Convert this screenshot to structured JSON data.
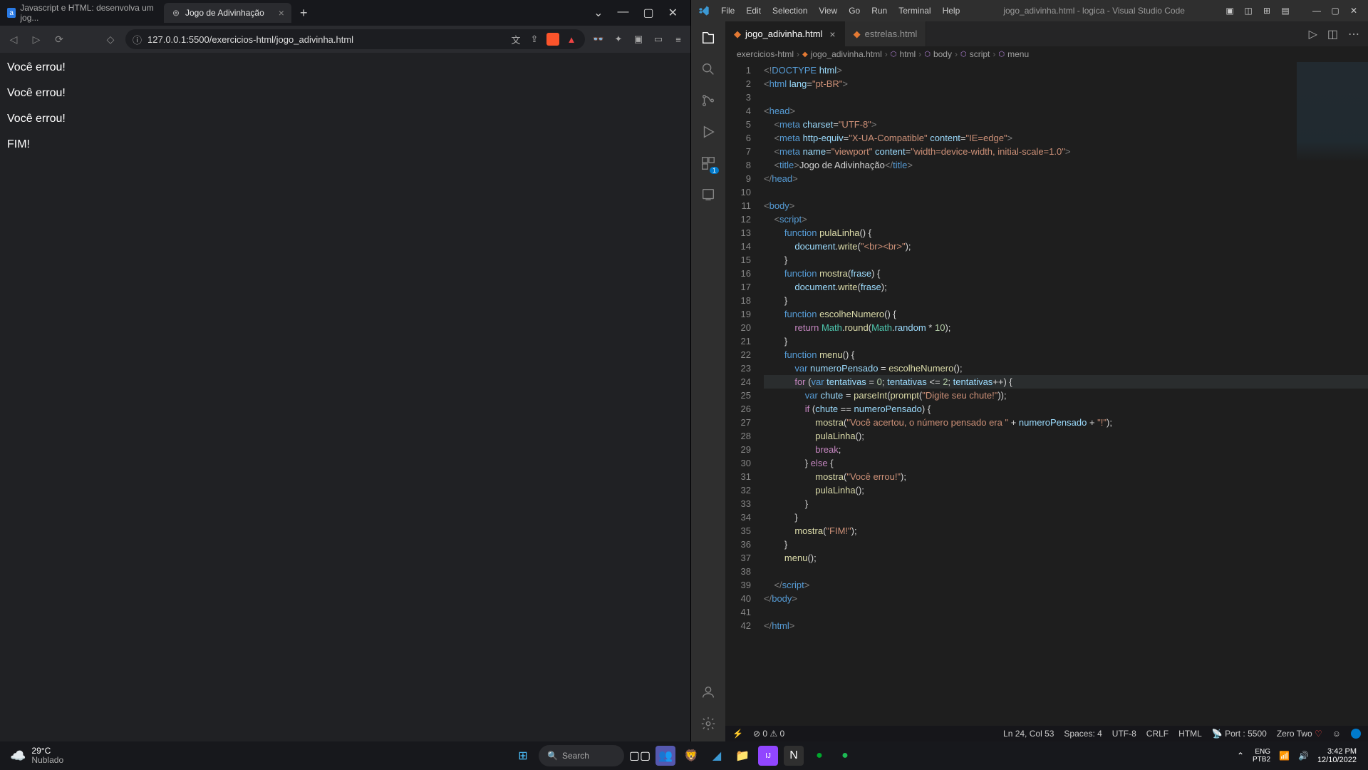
{
  "browser": {
    "tabs": [
      {
        "title": "Javascript e HTML: desenvolva um jog...",
        "icon": "a"
      },
      {
        "title": "Jogo de Adivinhação",
        "active": true
      }
    ],
    "url": "127.0.0.1:5500/exercicios-html/jogo_adivinha.html",
    "page_lines": [
      "Você errou!",
      "Você errou!",
      "Você errou!",
      "FIM!"
    ]
  },
  "vscode": {
    "title": "jogo_adivinha.html - logica - Visual Studio Code",
    "menus": [
      "File",
      "Edit",
      "Selection",
      "View",
      "Go",
      "Run",
      "Terminal",
      "Help"
    ],
    "tabs": [
      {
        "name": "jogo_adivinha.html",
        "active": true
      },
      {
        "name": "estrelas.html",
        "active": false
      }
    ],
    "breadcrumbs": [
      "exercicios-html",
      "jogo_adivinha.html",
      "html",
      "body",
      "script",
      "menu"
    ],
    "extensions_badge": "1",
    "status": {
      "errors": "0",
      "warnings": "0",
      "ln_col": "Ln 24, Col 53",
      "spaces": "Spaces: 4",
      "encoding": "UTF-8",
      "eol": "CRLF",
      "lang": "HTML",
      "port": "Port : 5500",
      "theme": "Zero Two"
    },
    "code": [
      {
        "n": 1,
        "html": "<span class='tk-tag'>&lt;!</span><span class='tk-doctype'>DOCTYPE</span> <span class='tk-attr'>html</span><span class='tk-tag'>&gt;</span>"
      },
      {
        "n": 2,
        "html": "<span class='tk-tag'>&lt;</span><span class='tk-el'>html</span> <span class='tk-attr'>lang</span>=<span class='tk-str'>\"pt-BR\"</span><span class='tk-tag'>&gt;</span>"
      },
      {
        "n": 3,
        "html": ""
      },
      {
        "n": 4,
        "html": "<span class='tk-tag'>&lt;</span><span class='tk-el'>head</span><span class='tk-tag'>&gt;</span>"
      },
      {
        "n": 5,
        "html": "    <span class='tk-tag'>&lt;</span><span class='tk-el'>meta</span> <span class='tk-attr'>charset</span>=<span class='tk-str'>\"UTF-8\"</span><span class='tk-tag'>&gt;</span>"
      },
      {
        "n": 6,
        "html": "    <span class='tk-tag'>&lt;</span><span class='tk-el'>meta</span> <span class='tk-attr'>http-equiv</span>=<span class='tk-str'>\"X-UA-Compatible\"</span> <span class='tk-attr'>content</span>=<span class='tk-str'>\"IE=edge\"</span><span class='tk-tag'>&gt;</span>"
      },
      {
        "n": 7,
        "html": "    <span class='tk-tag'>&lt;</span><span class='tk-el'>meta</span> <span class='tk-attr'>name</span>=<span class='tk-str'>\"viewport\"</span> <span class='tk-attr'>content</span>=<span class='tk-str'>\"width=device-width, initial-scale=1.0\"</span><span class='tk-tag'>&gt;</span>"
      },
      {
        "n": 8,
        "html": "    <span class='tk-tag'>&lt;</span><span class='tk-el'>title</span><span class='tk-tag'>&gt;</span>Jogo de Adivinhação<span class='tk-tag'>&lt;/</span><span class='tk-el'>title</span><span class='tk-tag'>&gt;</span>"
      },
      {
        "n": 9,
        "html": "<span class='tk-tag'>&lt;/</span><span class='tk-el'>head</span><span class='tk-tag'>&gt;</span>"
      },
      {
        "n": 10,
        "html": ""
      },
      {
        "n": 11,
        "html": "<span class='tk-tag'>&lt;</span><span class='tk-el'>body</span><span class='tk-tag'>&gt;</span>"
      },
      {
        "n": 12,
        "html": "    <span class='tk-tag'>&lt;</span><span class='tk-el'>script</span><span class='tk-tag'>&gt;</span>"
      },
      {
        "n": 13,
        "html": "        <span class='tk-kw'>function</span> <span class='tk-fn'>pulaLinha</span>() {"
      },
      {
        "n": 14,
        "html": "            <span class='tk-var'>document</span>.<span class='tk-fn'>write</span>(<span class='tk-str'>\"&lt;br&gt;&lt;br&gt;\"</span>);"
      },
      {
        "n": 15,
        "html": "        }"
      },
      {
        "n": 16,
        "html": "        <span class='tk-kw'>function</span> <span class='tk-fn'>mostra</span>(<span class='tk-var'>frase</span>) {"
      },
      {
        "n": 17,
        "html": "            <span class='tk-var'>document</span>.<span class='tk-fn'>write</span>(<span class='tk-var'>frase</span>);"
      },
      {
        "n": 18,
        "html": "        }"
      },
      {
        "n": 19,
        "html": "        <span class='tk-kw'>function</span> <span class='tk-fn'>escolheNumero</span>() {"
      },
      {
        "n": 20,
        "html": "            <span class='tk-kw2'>return</span> <span class='tk-obj'>Math</span>.<span class='tk-fn'>round</span>(<span class='tk-obj'>Math</span>.<span class='tk-var'>random</span> * <span class='tk-num'>10</span>);"
      },
      {
        "n": 21,
        "html": "        }"
      },
      {
        "n": 22,
        "html": "        <span class='tk-kw'>function</span> <span class='tk-fn'>menu</span>() {"
      },
      {
        "n": 23,
        "html": "            <span class='tk-kw'>var</span> <span class='tk-var'>numeroPensado</span> = <span class='tk-fn'>escolheNumero</span>();"
      },
      {
        "n": 24,
        "html": "            <span class='tk-kw2'>for</span> (<span class='tk-kw'>var</span> <span class='tk-var'>tentativas</span> = <span class='tk-num'>0</span>; <span class='tk-var'>tentativas</span> &lt;= <span class='tk-num'>2</span>; <span class='tk-var'>tentativas</span>++) {",
        "hl": true
      },
      {
        "n": 25,
        "html": "                <span class='tk-kw'>var</span> <span class='tk-var'>chute</span> = <span class='tk-fn'>parseInt</span>(<span class='tk-fn'>prompt</span>(<span class='tk-str'>\"Digite seu chute!\"</span>));"
      },
      {
        "n": 26,
        "html": "                <span class='tk-kw2'>if</span> (<span class='tk-var'>chute</span> == <span class='tk-var'>numeroPensado</span>) {"
      },
      {
        "n": 27,
        "html": "                    <span class='tk-fn'>mostra</span>(<span class='tk-str'>\"Você acertou, o número pensado era \"</span> + <span class='tk-var'>numeroPensado</span> + <span class='tk-str'>\"!\"</span>);"
      },
      {
        "n": 28,
        "html": "                    <span class='tk-fn'>pulaLinha</span>();"
      },
      {
        "n": 29,
        "html": "                    <span class='tk-kw2'>break</span>;"
      },
      {
        "n": 30,
        "html": "                } <span class='tk-kw2'>else</span> {"
      },
      {
        "n": 31,
        "html": "                    <span class='tk-fn'>mostra</span>(<span class='tk-str'>\"Você errou!\"</span>);"
      },
      {
        "n": 32,
        "html": "                    <span class='tk-fn'>pulaLinha</span>();"
      },
      {
        "n": 33,
        "html": "                }"
      },
      {
        "n": 34,
        "html": "            }"
      },
      {
        "n": 35,
        "html": "            <span class='tk-fn'>mostra</span>(<span class='tk-str'>\"FIM!\"</span>);"
      },
      {
        "n": 36,
        "html": "        }"
      },
      {
        "n": 37,
        "html": "        <span class='tk-fn'>menu</span>();"
      },
      {
        "n": 38,
        "html": ""
      },
      {
        "n": 39,
        "html": "    <span class='tk-tag'>&lt;/</span><span class='tk-el'>script</span><span class='tk-tag'>&gt;</span>"
      },
      {
        "n": 40,
        "html": "<span class='tk-tag'>&lt;/</span><span class='tk-el'>body</span><span class='tk-tag'>&gt;</span>"
      },
      {
        "n": 41,
        "html": ""
      },
      {
        "n": 42,
        "html": "<span class='tk-tag'>&lt;/</span><span class='tk-el'>html</span><span class='tk-tag'>&gt;</span>"
      }
    ]
  },
  "taskbar": {
    "weather_temp": "29°C",
    "weather_desc": "Nublado",
    "search_placeholder": "Search",
    "lang1": "ENG",
    "lang2": "PTB2",
    "time": "3:42 PM",
    "date": "12/10/2022"
  }
}
